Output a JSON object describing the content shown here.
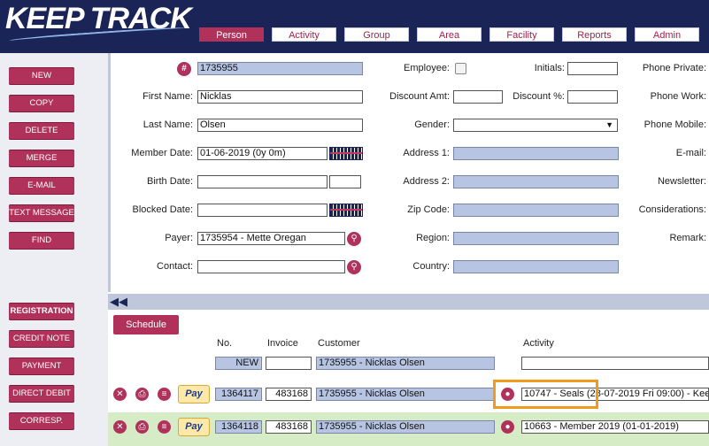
{
  "app": {
    "logo": "KEEP TRACK"
  },
  "tabs": [
    {
      "label": "Person",
      "active": true
    },
    {
      "label": "Activity",
      "active": false
    },
    {
      "label": "Group",
      "active": false
    },
    {
      "label": "Area",
      "active": false
    },
    {
      "label": "Facility",
      "active": false
    },
    {
      "label": "Reports",
      "active": false
    },
    {
      "label": "Admin",
      "active": false
    }
  ],
  "sidebar": {
    "top": [
      "NEW",
      "COPY",
      "DELETE",
      "MERGE",
      "E-MAIL",
      "TEXT MESSAGE",
      "FIND"
    ],
    "bottom": [
      "REGISTRATION",
      "CREDIT NOTE",
      "PAYMENT",
      "DIRECT DEBIT",
      "CORRESP."
    ]
  },
  "form": {
    "id_icon": "#",
    "id_value": "1735955",
    "first_name_label": "First Name:",
    "first_name": "Nicklas",
    "last_name_label": "Last Name:",
    "last_name": "Olsen",
    "member_date_label": "Member Date:",
    "member_date": "01-06-2019 (0y 0m)",
    "birth_date_label": "Birth Date:",
    "birth_date": "",
    "blocked_date_label": "Blocked Date:",
    "blocked_date": "",
    "payer_label": "Payer:",
    "payer": "1735954 - Mette Oregan",
    "contact_label": "Contact:",
    "contact": "",
    "employee_label": "Employee:",
    "employee_checked": false,
    "discount_amt_label": "Discount Amt:",
    "discount_amt": "",
    "gender_label": "Gender:",
    "gender": "",
    "address1_label": "Address 1:",
    "address1": "",
    "address2_label": "Address 2:",
    "address2": "",
    "zip_label": "Zip Code:",
    "zip": "",
    "region_label": "Region:",
    "region": "",
    "country_label": "Country:",
    "country": "",
    "initials_label": "Initials:",
    "initials": "",
    "discount_pct_label": "Discount %:",
    "discount_pct": "",
    "phone_private_label": "Phone Private:",
    "phone_work_label": "Phone Work:",
    "phone_mobile_label": "Phone Mobile:",
    "email_label": "E-mail:",
    "newsletter_label": "Newsletter:",
    "considerations_label": "Considerations:",
    "remark_label": "Remark:"
  },
  "registrations": {
    "schedule_label": "Schedule",
    "headers": {
      "no": "No.",
      "invoice": "Invoice",
      "customer": "Customer",
      "activity": "Activity"
    },
    "new_row": {
      "no": "NEW",
      "invoice": "",
      "customer": "1735955 - Nicklas Olsen",
      "activity": ""
    },
    "rows": [
      {
        "pay": "Pay",
        "no": "1364117",
        "invoice": "483168",
        "customer": "1735955 - Nicklas Olsen",
        "activity": "10747 - Seals (28-07-2019 Fri 09:00) - Kee"
      },
      {
        "pay": "Pay",
        "no": "1364118",
        "invoice": "483168",
        "customer": "1735955 - Nicklas Olsen",
        "activity": "10663 - Member 2019 (01-01-2019)"
      }
    ]
  },
  "colors": {
    "navy": "#1b2457",
    "accent": "#b0325a",
    "highlight": "#f29a1e"
  }
}
